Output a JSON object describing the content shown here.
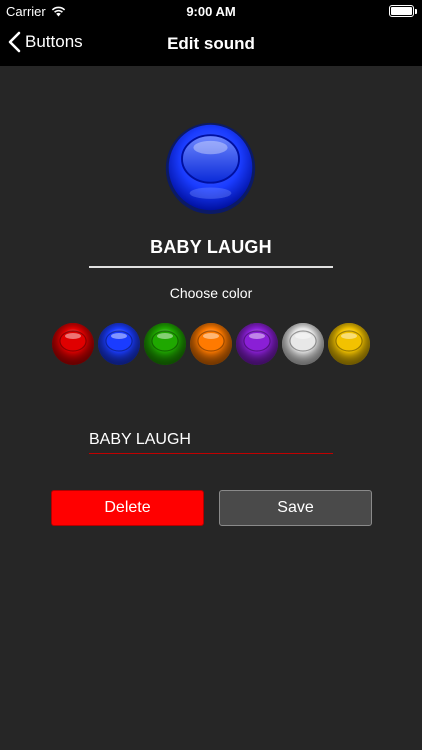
{
  "status_bar": {
    "carrier": "Carrier",
    "time": "9:00 AM",
    "wifi_icon": "wifi-icon",
    "battery_icon": "battery-icon"
  },
  "nav": {
    "back_label": "Buttons",
    "back_icon": "chevron-left-icon",
    "title": "Edit sound"
  },
  "sound": {
    "name": "BABY LAUGH",
    "selected_color": "#1a3cff"
  },
  "color_picker": {
    "label": "Choose color",
    "colors": [
      {
        "name": "red",
        "hex": "#e00000"
      },
      {
        "name": "blue",
        "hex": "#1a3cff"
      },
      {
        "name": "green",
        "hex": "#1fa800"
      },
      {
        "name": "orange",
        "hex": "#ff7a00"
      },
      {
        "name": "purple",
        "hex": "#8a1fd6"
      },
      {
        "name": "white",
        "hex": "#e8e8e8"
      },
      {
        "name": "yellow",
        "hex": "#f2c200"
      }
    ]
  },
  "name_field": {
    "value": "BABY LAUGH",
    "underline_color": "#c00000"
  },
  "actions": {
    "delete_label": "Delete",
    "save_label": "Save",
    "delete_color": "#ff0000"
  }
}
